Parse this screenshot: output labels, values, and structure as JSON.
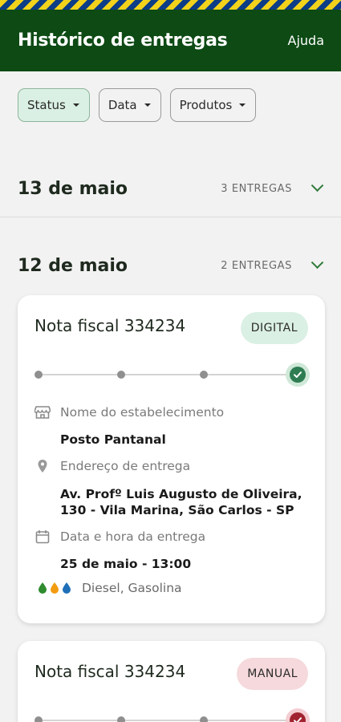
{
  "header": {
    "title": "Histórico de entregas",
    "help": "Ajuda"
  },
  "filters": [
    {
      "label": "Status",
      "active": true
    },
    {
      "label": "Data",
      "active": false
    },
    {
      "label": "Produtos",
      "active": false
    }
  ],
  "sections": [
    {
      "date": "13 de maio",
      "count": "3 ENTREGAS"
    },
    {
      "date": "12 de maio",
      "count": "2 ENTREGAS"
    }
  ],
  "cards": [
    {
      "title": "Nota fiscal 334234",
      "badge": "DIGITAL",
      "status": "completed",
      "establishment_label": "Nome do estabelecimento",
      "establishment": "Posto Pantanal",
      "address_label": "Endereço de entrega",
      "address": "Av. Profº Luis Augusto de Oliveira, 130 - Vila Marina, São Carlos - SP",
      "datetime_label": "Data e hora da entrega",
      "datetime": "25 de maio - 13:00",
      "fuels": "Diesel, Gasolina",
      "fuel_colors": [
        "#2e8b2e",
        "#f39c12",
        "#1e6fb8"
      ]
    },
    {
      "title": "Nota fiscal 334234",
      "badge": "MANUAL",
      "status": "failed"
    }
  ],
  "colors": {
    "brand": "#0d4a14",
    "accent": "#2f7a3a",
    "success": "#2e7d52",
    "error": "#a1232f"
  }
}
